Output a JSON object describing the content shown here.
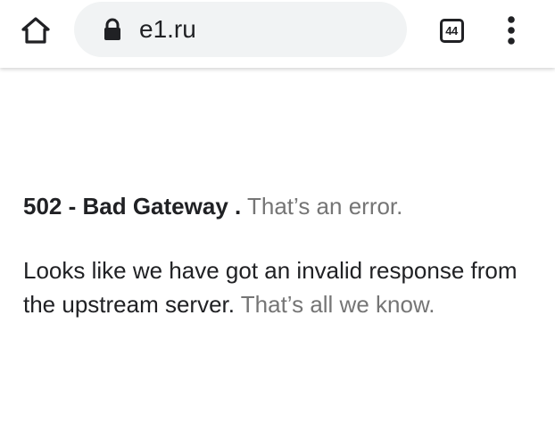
{
  "browser": {
    "url": "e1.ru",
    "tab_count": "44"
  },
  "page": {
    "error_code": "502 - Bad Gateway .",
    "error_suffix": "That’s an error.",
    "description": "Looks like we have got an invalid response from the upstream server.",
    "description_suffix": "That’s all we know."
  }
}
